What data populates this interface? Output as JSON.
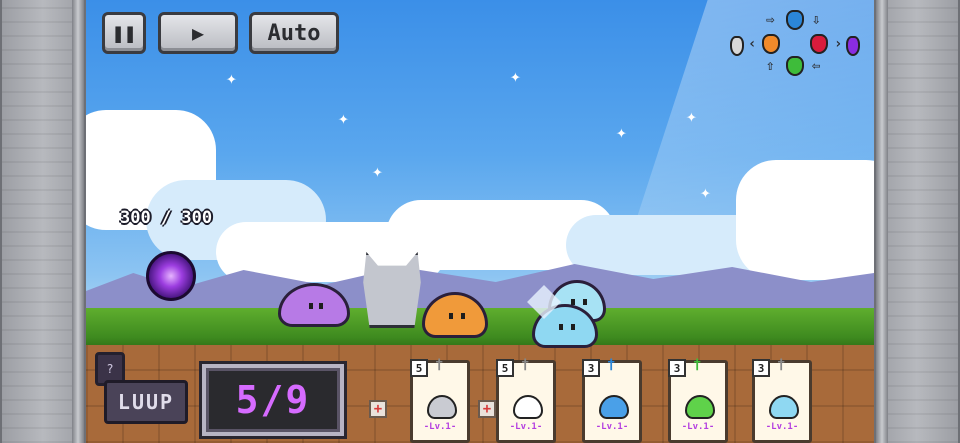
{
  "controls": {
    "pause_icon": "pause-icon",
    "play_icon": "play-icon",
    "auto_label": "Auto"
  },
  "element_wheel": {
    "gems": [
      {
        "name": "water-gem",
        "color": "#2b86d8"
      },
      {
        "name": "fire-gem",
        "color": "#f08a2a"
      },
      {
        "name": "blood-gem",
        "color": "#d81c3c"
      },
      {
        "name": "earth-gem",
        "color": "#3ebc3a"
      },
      {
        "name": "light-gem",
        "color": "#d8d8d8"
      },
      {
        "name": "dark-gem",
        "color": "#8a2ce0"
      }
    ]
  },
  "player": {
    "hp_text": "300 / 300"
  },
  "hud": {
    "luup_label": "LUUP",
    "luup_slot": "?",
    "counter_text": "5/9",
    "plus_symbol": "+"
  },
  "cards": [
    {
      "cost": "5",
      "lv": "-Lv.1-",
      "monster": "wolf",
      "color": "#c9cbd2"
    },
    {
      "cost": "5",
      "lv": "-Lv.1-",
      "monster": "rabbit",
      "color": "#ffffff"
    },
    {
      "cost": "3",
      "lv": "-Lv.1-",
      "monster": "blue-slime",
      "color": "#4aa0e8"
    },
    {
      "cost": "3",
      "lv": "-Lv.1-",
      "monster": "green-slime",
      "color": "#5fd24a"
    },
    {
      "cost": "3",
      "lv": "-Lv.1-",
      "monster": "cyan-slime",
      "color": "#8fd8f2"
    }
  ],
  "colors": {
    "counter_text": "#d66bff",
    "sky": "#3b8fe8",
    "grass": "#5fae2e",
    "dirt": "#a86a3a"
  }
}
